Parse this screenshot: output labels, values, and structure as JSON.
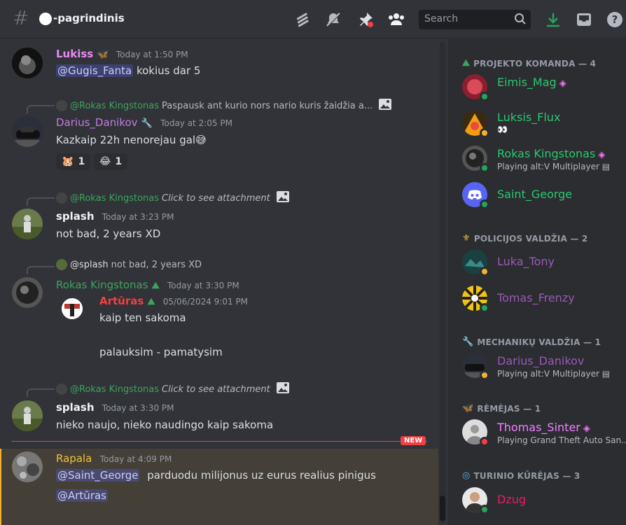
{
  "header": {
    "channel_name": "-pagrindinis",
    "search_placeholder": "Search"
  },
  "messages": [
    {
      "author": "Lukiss",
      "author_color": "#e78cf5",
      "timestamp": "Today at 1:50 PM",
      "mention": "@Gugis_Fanta",
      "text": "kokius dar 5"
    },
    {
      "reply_to": "@Rokas Kingstonas",
      "reply_text": "Paspausk ant kurio nors nario kuris žaidžia a...",
      "author": "Darius_Danikov",
      "author_color": "#c27ce0",
      "timestamp": "Today at 2:05 PM",
      "text": "Kazkaip 22h nenorejau gal",
      "reactions": [
        {
          "emoji": "🐹",
          "count": "1"
        },
        {
          "emoji": "😂",
          "count": "1"
        }
      ]
    },
    {
      "reply_to": "@Rokas Kingstonas",
      "reply_text": "Click to see attachment",
      "author": "splash",
      "author_color": "#f2f3f5",
      "timestamp": "Today at 3:23 PM",
      "text": "not bad, 2 years XD"
    },
    {
      "reply_to": "@splash",
      "reply_text": "not bad, 2 years XD",
      "author": "Rokas Kingstonas",
      "author_color": "#3ba55c",
      "timestamp": "Today at 3:30 PM",
      "forward": {
        "author": "Artūras",
        "timestamp": "05/06/2024 9:01 PM",
        "line1": "kaip ten sakoma",
        "line2": "palauksim - pamatysim"
      }
    },
    {
      "reply_to": "@Rokas Kingstonas",
      "reply_text": "Click to see attachment",
      "author": "splash",
      "author_color": "#f2f3f5",
      "timestamp": "Today at 3:30 PM",
      "text": "nieko naujo, nieko naudingo kaip sakoma"
    },
    {
      "author": "Rapala",
      "author_color": "#f0c23b",
      "timestamp": "Today at 4:09 PM",
      "mention": "@Saint_George",
      "text": "parduodu milijonus uz eurus realius pinigus",
      "mention2": "@Artūras"
    }
  ],
  "new_badge": "NEW",
  "members": {
    "roles": [
      {
        "title": "PROJEKTO KOMANDA — 4",
        "members": [
          {
            "name": "Eimis_Mag",
            "color": "#2dc770",
            "status": "online",
            "sub": ""
          },
          {
            "name": "Luksis_Flux",
            "color": "#2dc770",
            "status": "idle",
            "sub": "👀"
          },
          {
            "name": "Rokas Kingstonas",
            "color": "#2dc770",
            "status": "online",
            "sub": "Playing alt:V Multiplayer"
          },
          {
            "name": "Saint_George",
            "color": "#2dc770",
            "status": "online",
            "sub": ""
          }
        ]
      },
      {
        "title": "POLICIJOS VALDŽIA — 2",
        "members": [
          {
            "name": "Luka_Tony",
            "color": "#9b59b6",
            "status": "idle",
            "sub": ""
          },
          {
            "name": "Tomas_Frenzy",
            "color": "#9b59b6",
            "status": "online",
            "sub": ""
          }
        ]
      },
      {
        "title": "MECHANIKŲ VALDŽIA — 1",
        "members": [
          {
            "name": "Darius_Danikov",
            "color": "#9b59b6",
            "status": "idle",
            "sub": "Playing alt:V Multiplayer"
          }
        ]
      },
      {
        "title": "RĖMĖJAS — 1",
        "members": [
          {
            "name": "Thomas_Sinter",
            "color": "#f47fff",
            "status": "dnd",
            "sub": "Playing Grand Theft Auto San..."
          }
        ]
      },
      {
        "title": "TURINIO KŪRĖJAS — 3",
        "members": [
          {
            "name": "Dzug",
            "color": "#e91e63",
            "status": "online",
            "sub": ""
          }
        ]
      }
    ]
  }
}
